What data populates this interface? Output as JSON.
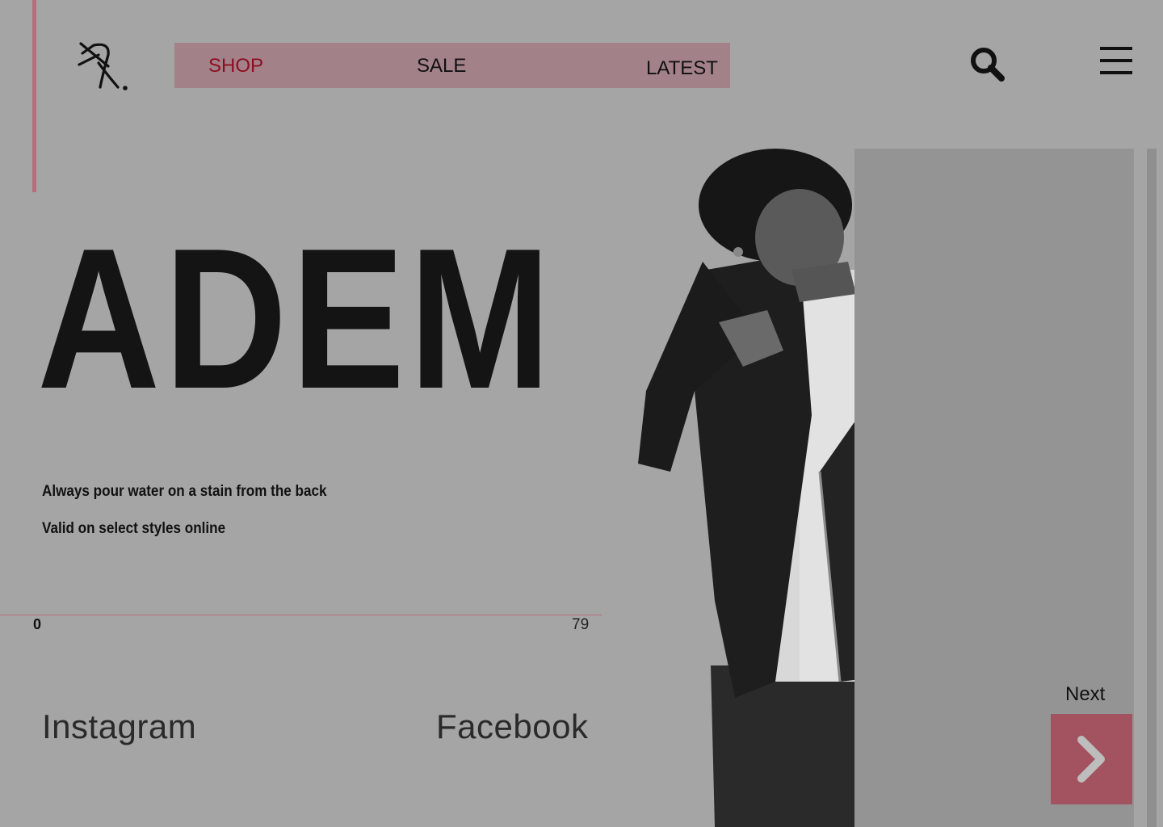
{
  "nav": {
    "items": [
      {
        "label": "SHOP",
        "active": true
      },
      {
        "label": "SALE",
        "active": false
      },
      {
        "label": "LATEST",
        "active": false
      }
    ]
  },
  "header": {
    "search_icon": "search-icon",
    "menu_icon": "hamburger-menu-icon"
  },
  "hero": {
    "title": "ADEM",
    "lines": [
      "Always pour water on a stain from the back",
      "Valid on select styles online"
    ]
  },
  "progress": {
    "start": "0",
    "end": "79"
  },
  "social": {
    "instagram": "Instagram",
    "facebook": "Facebook"
  },
  "pager": {
    "next_label": "Next",
    "next_icon": "chevron-right-icon"
  },
  "colors": {
    "background": "#a5a5a5",
    "accent": "#b56f7e",
    "nav_bg": "#a38189",
    "active_nav": "#8b0f20",
    "next_button": "#a3535f"
  }
}
